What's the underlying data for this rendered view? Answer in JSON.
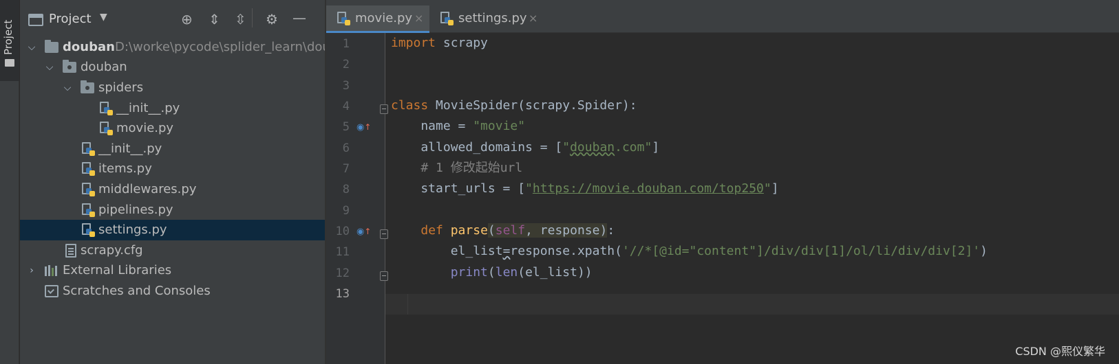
{
  "sidebar_stripe": {
    "label": "Project"
  },
  "project_panel": {
    "title": "Project",
    "tree": [
      {
        "label": "douban",
        "path": "D:\\worke\\pycode\\splider_learn\\dou",
        "type": "root"
      },
      {
        "label": "douban",
        "type": "package"
      },
      {
        "label": "spiders",
        "type": "package"
      },
      {
        "label": "__init__.py",
        "type": "python"
      },
      {
        "label": "movie.py",
        "type": "python"
      },
      {
        "label": "__init__.py",
        "type": "python"
      },
      {
        "label": "items.py",
        "type": "python"
      },
      {
        "label": "middlewares.py",
        "type": "python"
      },
      {
        "label": "pipelines.py",
        "type": "python"
      },
      {
        "label": "settings.py",
        "type": "python",
        "selected": true
      },
      {
        "label": "scrapy.cfg",
        "type": "config"
      },
      {
        "label": "External Libraries",
        "type": "libraries"
      },
      {
        "label": "Scratches and Consoles",
        "type": "scratches"
      }
    ]
  },
  "tabs": [
    {
      "label": "movie.py",
      "active": true,
      "close": "×"
    },
    {
      "label": "settings.py",
      "active": false,
      "close": "×"
    }
  ],
  "editor": {
    "line_numbers": [
      "1",
      "2",
      "3",
      "4",
      "5",
      "6",
      "7",
      "8",
      "9",
      "10",
      "11",
      "12",
      "13"
    ],
    "current_line": "13",
    "lines": {
      "l1": [
        "import",
        " scrapy"
      ],
      "l4": [
        "class",
        " MovieSpider(scrapy.Spider):"
      ],
      "l5": [
        "    name = ",
        "\"movie\""
      ],
      "l6": [
        "    allowed_domains = [",
        "\"",
        "douban",
        ".com\"",
        "]"
      ],
      "l7": [
        "    # 1 修改起始url"
      ],
      "l8": [
        "    start_urls = [",
        "\"",
        "https://movie.douban.com/top250",
        "\"",
        "]"
      ],
      "l10": [
        "    ",
        "def",
        " ",
        "parse",
        "(",
        "self",
        ", response",
        ")",
        ":"
      ],
      "l11": [
        "        el_list",
        "=",
        "response.xpath(",
        "'//*[@id=\"content\"]/div/div[1]/ol/li/div/div[2]'",
        ")"
      ],
      "l12": [
        "        ",
        "print",
        "(",
        "len",
        "(el_list))"
      ]
    }
  },
  "watermark": "CSDN @熙仪繁华",
  "colors": {
    "keyword": "#cc7832",
    "string": "#6a8759",
    "function": "#ffc66d",
    "self": "#94558d",
    "builtin": "#8888c6",
    "comment": "#808080",
    "text": "#a9b7c6",
    "selection": "#0d293e"
  },
  "icons": [
    "project-icon",
    "locate-icon",
    "expand-all-icon",
    "collapse-all-icon",
    "gear-icon",
    "minimize-icon",
    "python-file-icon",
    "folder-icon"
  ]
}
